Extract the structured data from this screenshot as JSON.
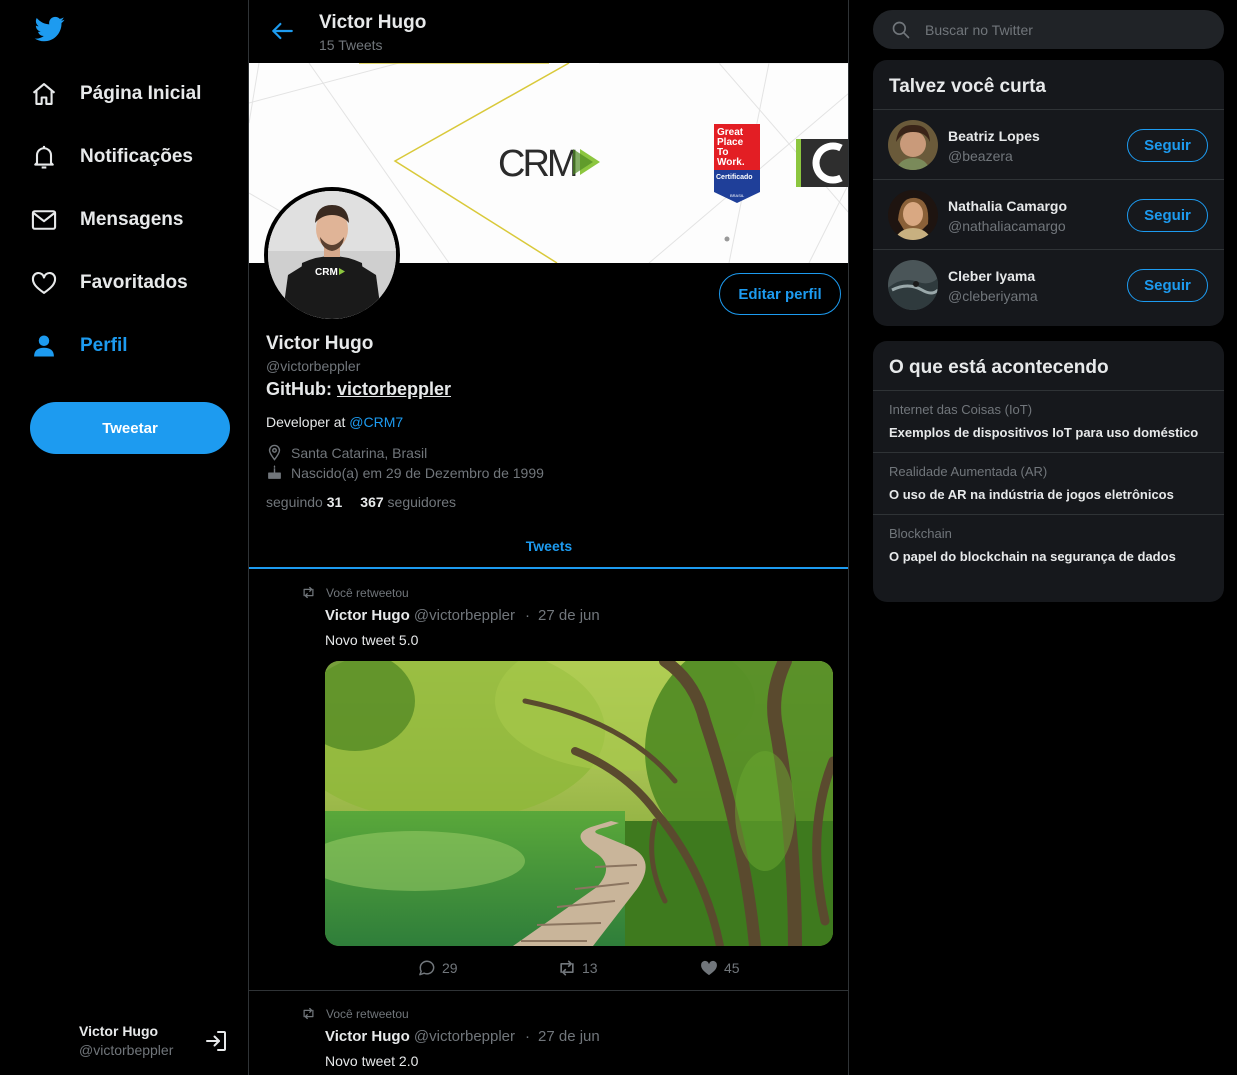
{
  "sidebar": {
    "items": [
      {
        "label": "Página Inicial",
        "icon": "home-icon"
      },
      {
        "label": "Notificações",
        "icon": "bell-icon"
      },
      {
        "label": "Mensagens",
        "icon": "mail-icon"
      },
      {
        "label": "Favoritados",
        "icon": "heart-icon"
      },
      {
        "label": "Perfil",
        "icon": "person-icon",
        "active": true
      }
    ],
    "tweet_button": "Tweetar",
    "user": {
      "name": "Victor Hugo",
      "handle": "@victorbeppler"
    }
  },
  "header": {
    "name": "Victor Hugo",
    "tweet_count": "15 Tweets"
  },
  "banner": {
    "logo_text": "CRM",
    "badge": {
      "line1": "Great",
      "line2": "Place",
      "line3": "To",
      "line4": "Work.",
      "certified": "Certificado",
      "country": "BRASIL"
    }
  },
  "profile": {
    "name": "Victor Hugo",
    "handle": "@victorbeppler",
    "github_prefix": "GitHub: ",
    "github_link": "victorbeppler",
    "bio_prefix": "Developer at ",
    "bio_mention": "@CRM7",
    "location": "Santa Catarina, Brasil",
    "birthday": "Nascido(a) em 29 de Dezembro de 1999",
    "following_label": "seguindo",
    "following_count": "31",
    "followers_count": "367",
    "followers_label": "seguidores",
    "edit_button": "Editar perfil",
    "avatar_shirt_text": "CRM"
  },
  "tabs": {
    "tweets": "Tweets"
  },
  "tweets": [
    {
      "retweet_label": "Você retweetou",
      "name": "Victor Hugo",
      "handle": "@victorbeppler",
      "separator": "·",
      "date": "27 de jun",
      "text": "Novo tweet 5.0",
      "replies": "29",
      "retweets": "13",
      "likes": "45"
    },
    {
      "retweet_label": "Você retweetou",
      "name": "Victor Hugo",
      "handle": "@victorbeppler",
      "separator": "·",
      "date": "27 de jun",
      "text": "Novo tweet 2.0"
    }
  ],
  "search": {
    "placeholder": "Buscar no Twitter"
  },
  "suggestions": {
    "title": "Talvez você curta",
    "follow_label": "Seguir",
    "users": [
      {
        "name": "Beatriz Lopes",
        "handle": "@beazera"
      },
      {
        "name": "Nathalia Camargo",
        "handle": "@nathaliacamargo"
      },
      {
        "name": "Cleber Iyama",
        "handle": "@cleberiyama"
      }
    ]
  },
  "trends": {
    "title": "O que está acontecendo",
    "items": [
      {
        "category": "Internet das Coisas (IoT)",
        "title": "Exemplos de dispositivos IoT para uso doméstico"
      },
      {
        "category": "Realidade Aumentada (AR)",
        "title": "O uso de AR na indústria de jogos eletrônicos"
      },
      {
        "category": "Blockchain",
        "title": "O papel do blockchain na segurança de dados"
      }
    ]
  },
  "colors": {
    "accent": "#1d9bf0",
    "background": "#000000",
    "card": "#16181c",
    "muted": "#71767b"
  }
}
